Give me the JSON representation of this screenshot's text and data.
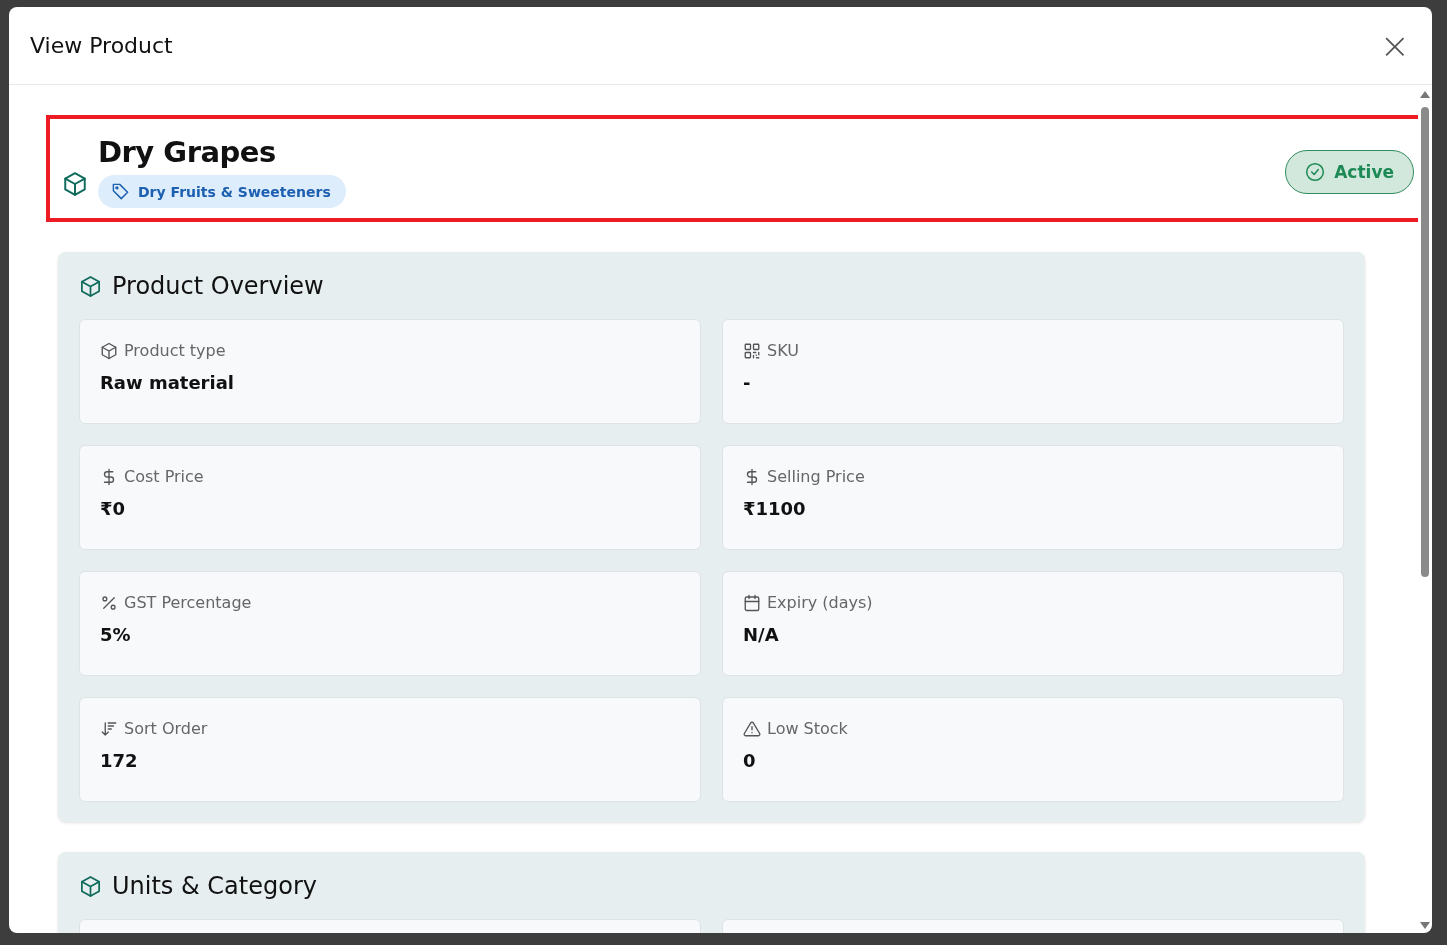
{
  "dialog": {
    "title": "View Product",
    "close_label": "×"
  },
  "product": {
    "name": "Dry Grapes",
    "category": "Dry Fruits & Sweeteners",
    "status": {
      "label": "Active",
      "active": true
    },
    "highlighted": true
  },
  "sections": [
    {
      "title": "Product Overview",
      "fields": [
        {
          "kind": "box",
          "label": "Product type",
          "value": "Raw material"
        },
        {
          "kind": "qr",
          "label": "SKU",
          "value": "-"
        },
        {
          "kind": "dollar",
          "label": "Cost Price",
          "value": "₹0"
        },
        {
          "kind": "dollar",
          "label": "Selling Price",
          "value": "₹1100"
        },
        {
          "kind": "percent",
          "label": "GST Percentage",
          "value": "5%"
        },
        {
          "kind": "calendar",
          "label": "Expiry (days)",
          "value": "N/A"
        },
        {
          "kind": "sort",
          "label": "Sort Order",
          "value": "172"
        },
        {
          "kind": "warning",
          "label": "Low Stock",
          "value": "0"
        }
      ]
    },
    {
      "title": "Units & Category",
      "fields": [
        {
          "kind": "empty"
        },
        {
          "kind": "empty"
        }
      ]
    }
  ]
}
